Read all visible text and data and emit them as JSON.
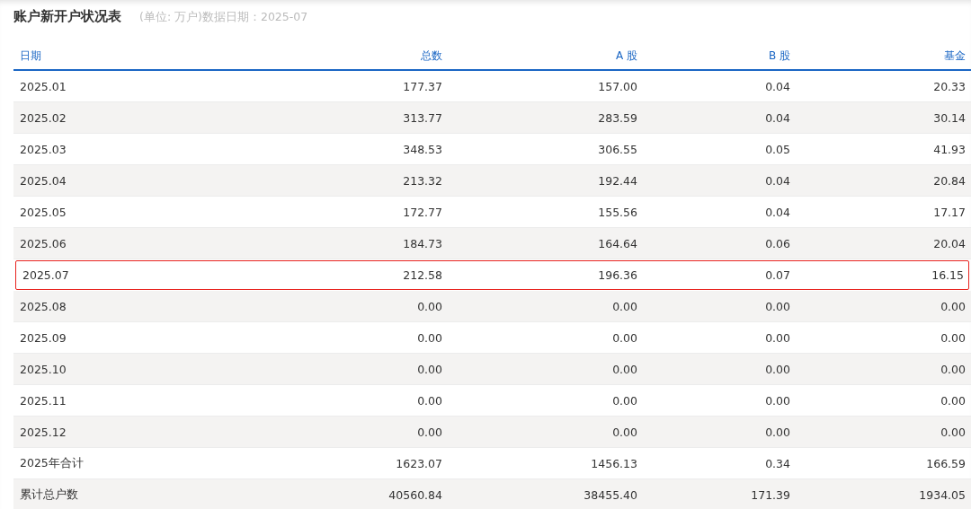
{
  "title": "账户新开户状况表",
  "subtitle": "(单位: 万户)数据日期：2025-07",
  "table": {
    "columns": [
      "日期",
      "总数",
      "A 股",
      "B 股",
      "基金"
    ],
    "rows": [
      {
        "cells": [
          "2025.01",
          "177.37",
          "157.00",
          "0.04",
          "20.33"
        ],
        "highlighted": false
      },
      {
        "cells": [
          "2025.02",
          "313.77",
          "283.59",
          "0.04",
          "30.14"
        ],
        "highlighted": false
      },
      {
        "cells": [
          "2025.03",
          "348.53",
          "306.55",
          "0.05",
          "41.93"
        ],
        "highlighted": false
      },
      {
        "cells": [
          "2025.04",
          "213.32",
          "192.44",
          "0.04",
          "20.84"
        ],
        "highlighted": false
      },
      {
        "cells": [
          "2025.05",
          "172.77",
          "155.56",
          "0.04",
          "17.17"
        ],
        "highlighted": false
      },
      {
        "cells": [
          "2025.06",
          "184.73",
          "164.64",
          "0.06",
          "20.04"
        ],
        "highlighted": false
      },
      {
        "cells": [
          "2025.07",
          "212.58",
          "196.36",
          "0.07",
          "16.15"
        ],
        "highlighted": true
      },
      {
        "cells": [
          "2025.08",
          "0.00",
          "0.00",
          "0.00",
          "0.00"
        ],
        "highlighted": false
      },
      {
        "cells": [
          "2025.09",
          "0.00",
          "0.00",
          "0.00",
          "0.00"
        ],
        "highlighted": false
      },
      {
        "cells": [
          "2025.10",
          "0.00",
          "0.00",
          "0.00",
          "0.00"
        ],
        "highlighted": false
      },
      {
        "cells": [
          "2025.11",
          "0.00",
          "0.00",
          "0.00",
          "0.00"
        ],
        "highlighted": false
      },
      {
        "cells": [
          "2025.12",
          "0.00",
          "0.00",
          "0.00",
          "0.00"
        ],
        "highlighted": false
      },
      {
        "cells": [
          "2025年合计",
          "1623.07",
          "1456.13",
          "0.34",
          "166.59"
        ],
        "highlighted": false
      },
      {
        "cells": [
          "累计总户数",
          "40560.84",
          "38455.40",
          "171.39",
          "1934.05"
        ],
        "highlighted": false
      }
    ]
  }
}
